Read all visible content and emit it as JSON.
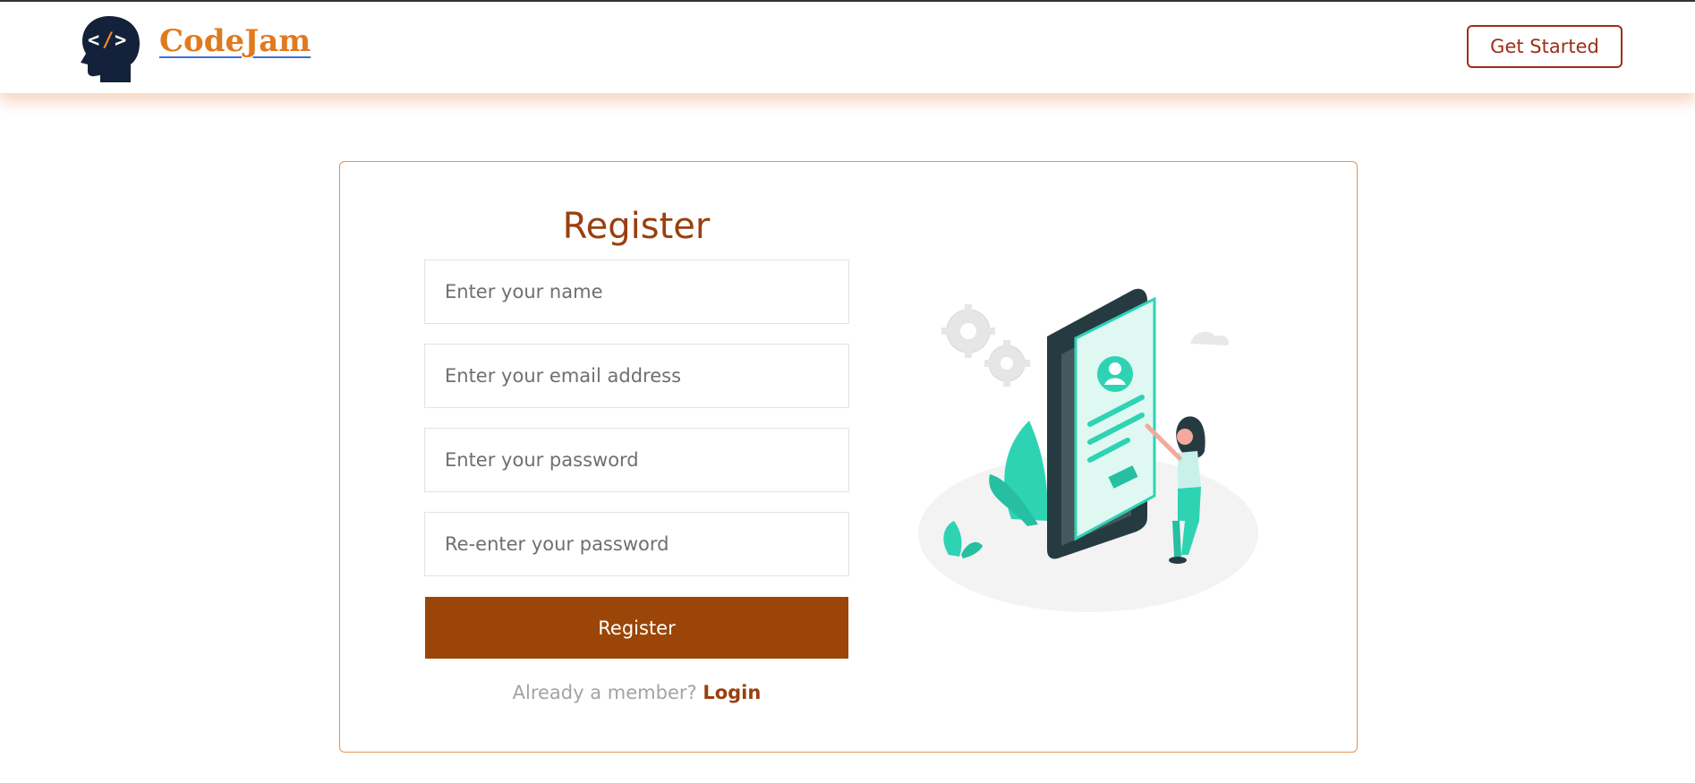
{
  "navbar": {
    "brand": "CodeJam",
    "logo_icon": "head-code-icon",
    "cta_label": "Get Started"
  },
  "form": {
    "title": "Register",
    "name_placeholder": "Enter your name",
    "email_placeholder": "Enter your email address",
    "password_placeholder": "Enter your password",
    "confirm_placeholder": "Re-enter your password",
    "submit_label": "Register",
    "member_text": "Already a member?",
    "login_label": "Login"
  },
  "illustration": {
    "icon": "registration-illustration"
  },
  "colors": {
    "brand": "#e07a1f",
    "accent": "#9b4509",
    "card_border": "#e8914a",
    "illustration_teal": "#2ed3b4"
  }
}
